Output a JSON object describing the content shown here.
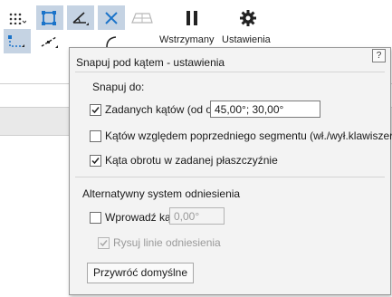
{
  "toolbar": {
    "pause_label": "Wstrzymany",
    "settings_label": "Ustawienia"
  },
  "popup": {
    "title": "Snapuj pod kątem - ustawienia",
    "help": "?",
    "snap_heading": "Snapuj do:",
    "option_given_angles": {
      "label": "Zadanych kątów (od osi):",
      "checked": true,
      "value": "45,00°; 30,00°"
    },
    "option_previous_segment": {
      "label": "Kątów względem poprzedniego segmentu (wł./wył.klawiszem :)",
      "checked": false
    },
    "option_rotation_plane": {
      "label": "Kąta obrotu w zadanej płaszczyźnie",
      "checked": true
    },
    "alt_heading": "Alternatywny system odniesienia",
    "option_enter_angle": {
      "label": "Wprowadź kąt:",
      "checked": false,
      "value": "0,00°"
    },
    "option_draw_lines": {
      "label": "Rysuj linie odniesienia",
      "checked": true,
      "disabled": true
    },
    "reset_button": "Przywróć domyślne"
  },
  "colors": {
    "accent": "#c5d3e3",
    "icon_blue": "#1a73c9"
  }
}
